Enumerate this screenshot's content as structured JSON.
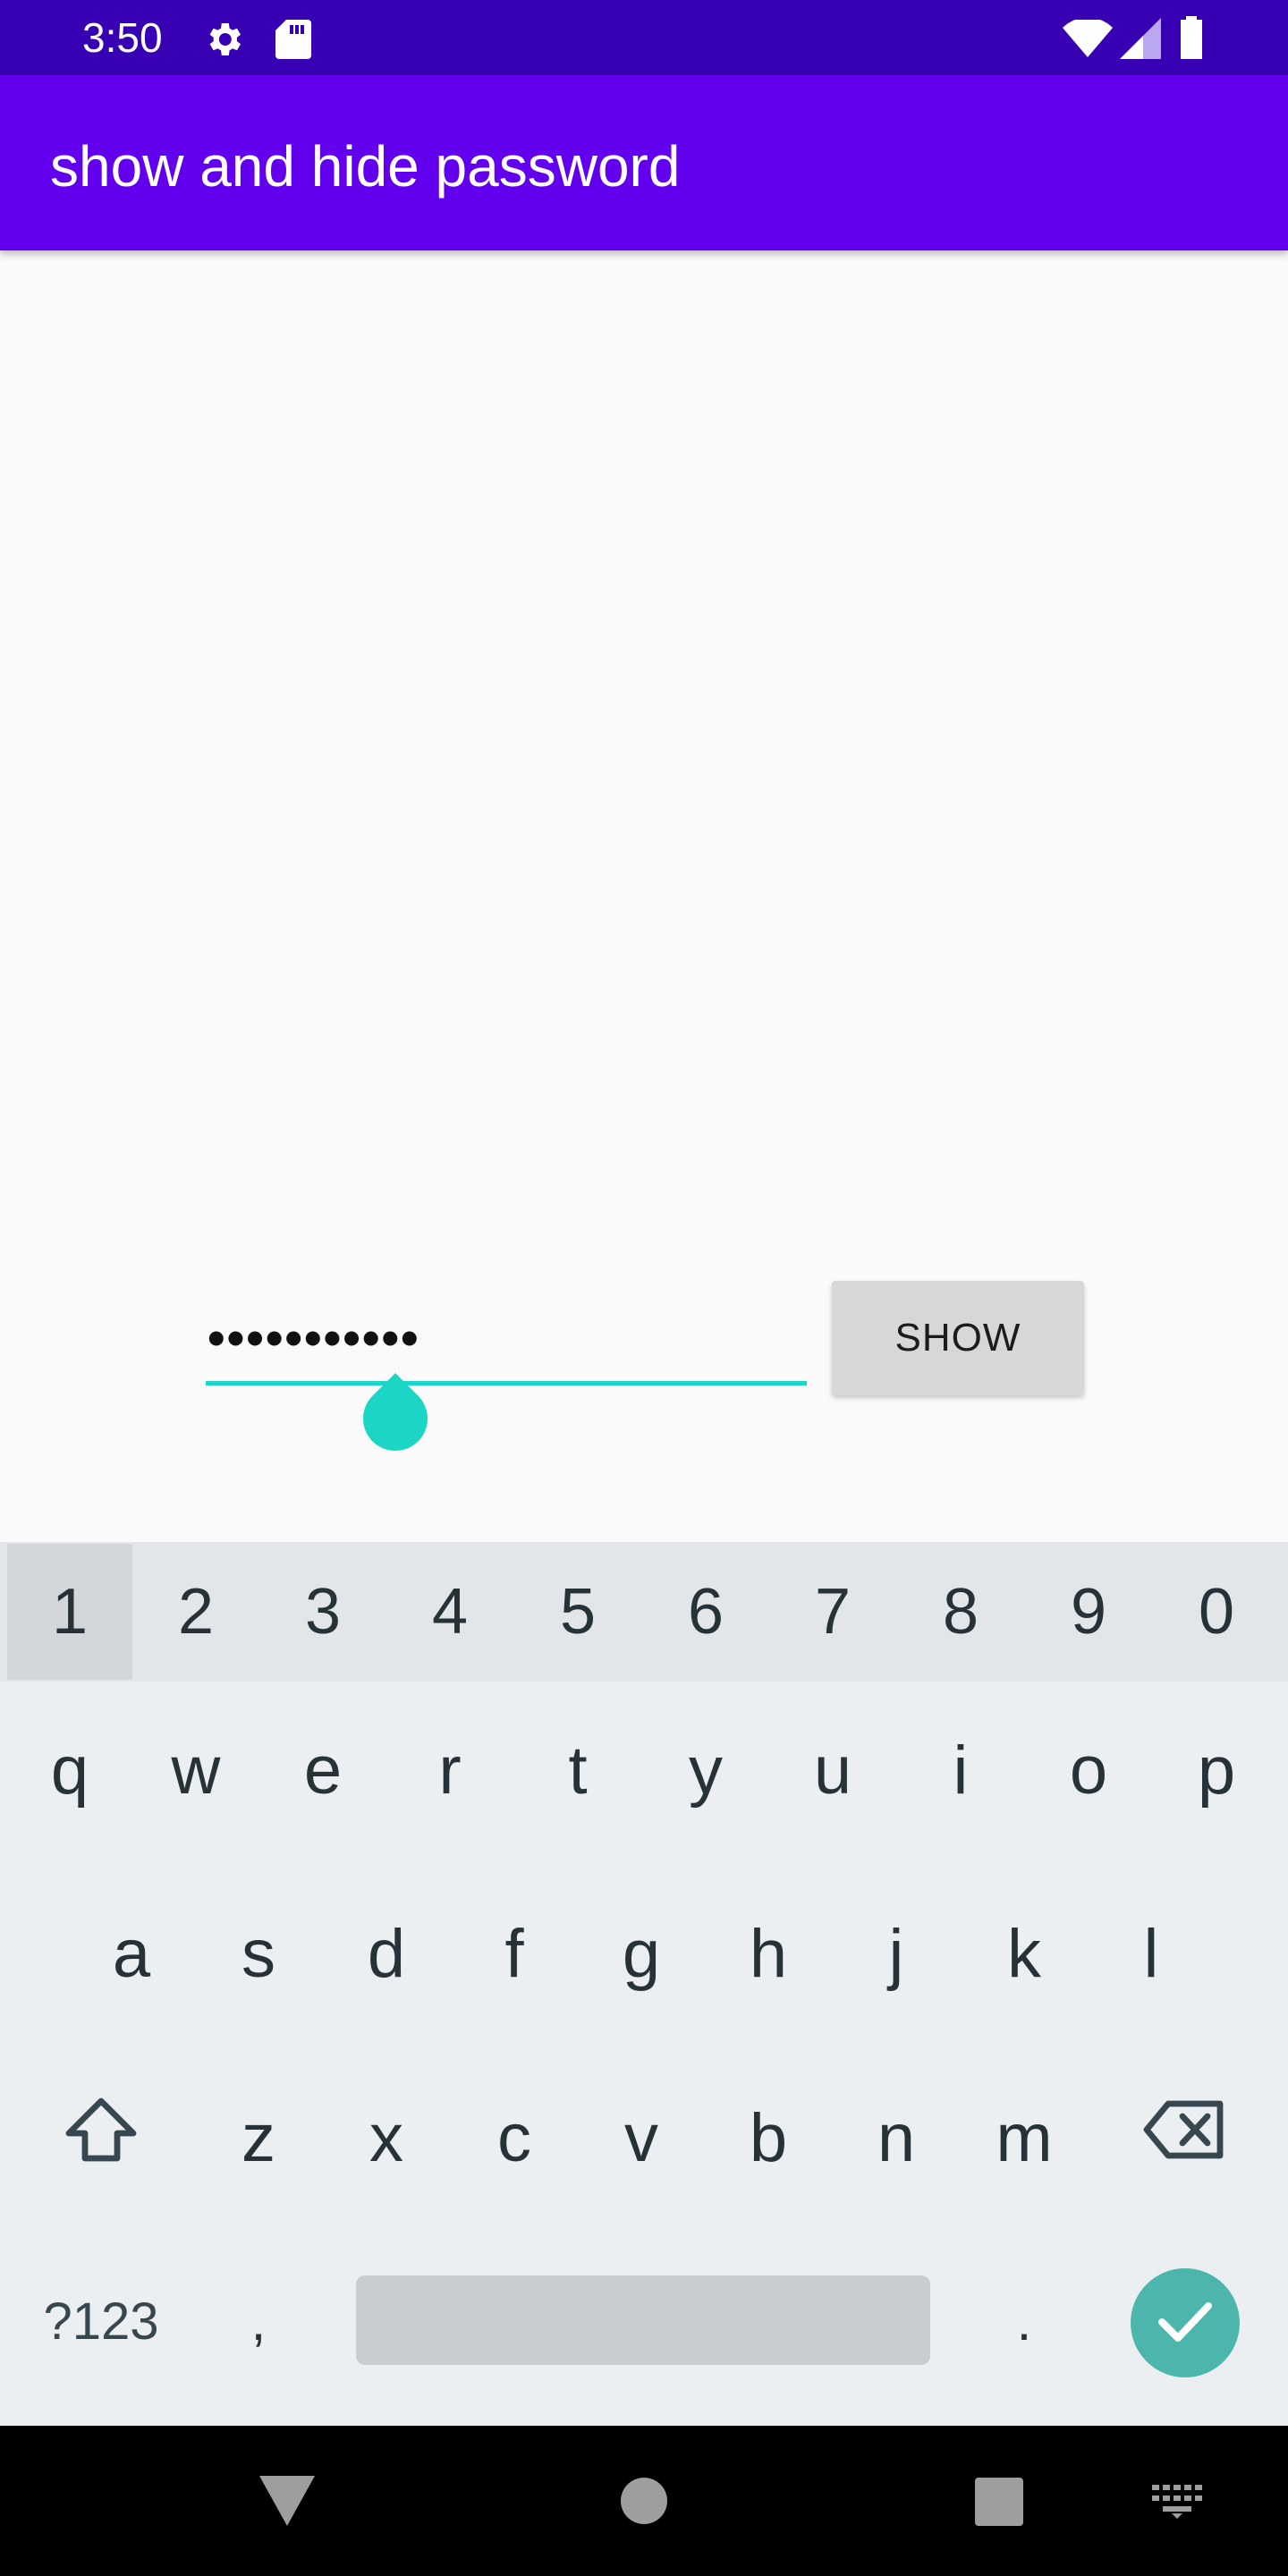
{
  "status_bar": {
    "time": "3:50",
    "icons": [
      "gear-icon",
      "sd-card-icon",
      "wifi-icon",
      "signal-icon",
      "battery-icon"
    ]
  },
  "app_bar": {
    "title": "show and hide password",
    "background": "#6200ee"
  },
  "password_field": {
    "value": "•••••••••••",
    "underline_color": "#1bd6c4"
  },
  "show_button": {
    "label": "SHOW"
  },
  "keyboard": {
    "number_row": [
      "1",
      "2",
      "3",
      "4",
      "5",
      "6",
      "7",
      "8",
      "9",
      "0"
    ],
    "row1": [
      "q",
      "w",
      "e",
      "r",
      "t",
      "y",
      "u",
      "i",
      "o",
      "p"
    ],
    "row2": [
      "a",
      "s",
      "d",
      "f",
      "g",
      "h",
      "j",
      "k",
      "l"
    ],
    "row3": [
      "z",
      "x",
      "c",
      "v",
      "b",
      "n",
      "m"
    ],
    "symbols_label": "?123",
    "comma": ",",
    "period": ".",
    "enter_color": "#4db6ac"
  },
  "nav_bar": {
    "buttons": [
      "back-icon",
      "home-icon",
      "recents-icon",
      "keyboard-switch-icon"
    ]
  }
}
